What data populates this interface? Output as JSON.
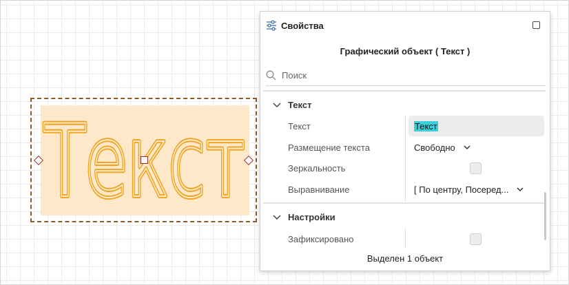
{
  "canvas": {
    "object_text": "Текст",
    "fill_color": "#fde9c9",
    "text_stroke_color": "#f0a21c",
    "selection_color": "#8a5a28"
  },
  "panel": {
    "title": "Свойства",
    "title_icon": "sliders-icon",
    "maximize_icon": "square-icon",
    "object_title": "Графический объект ( Текст )",
    "search": {
      "placeholder": "Поиск",
      "icon": "search-icon"
    },
    "sections": [
      {
        "label": "Текст",
        "properties": [
          {
            "label": "Текст",
            "value": "Текст"
          },
          {
            "label": "Размещение текста",
            "value": "Свободно"
          },
          {
            "label": "Зеркальность",
            "checked": false
          },
          {
            "label": "Выравнивание",
            "value": "[ По центру, Посеред..."
          }
        ]
      },
      {
        "label": "Настройки",
        "properties": [
          {
            "label": "Зафиксировано",
            "checked": false
          }
        ]
      }
    ],
    "status": "Выделен 1 объект",
    "highlight_color": "#39d0dc"
  }
}
